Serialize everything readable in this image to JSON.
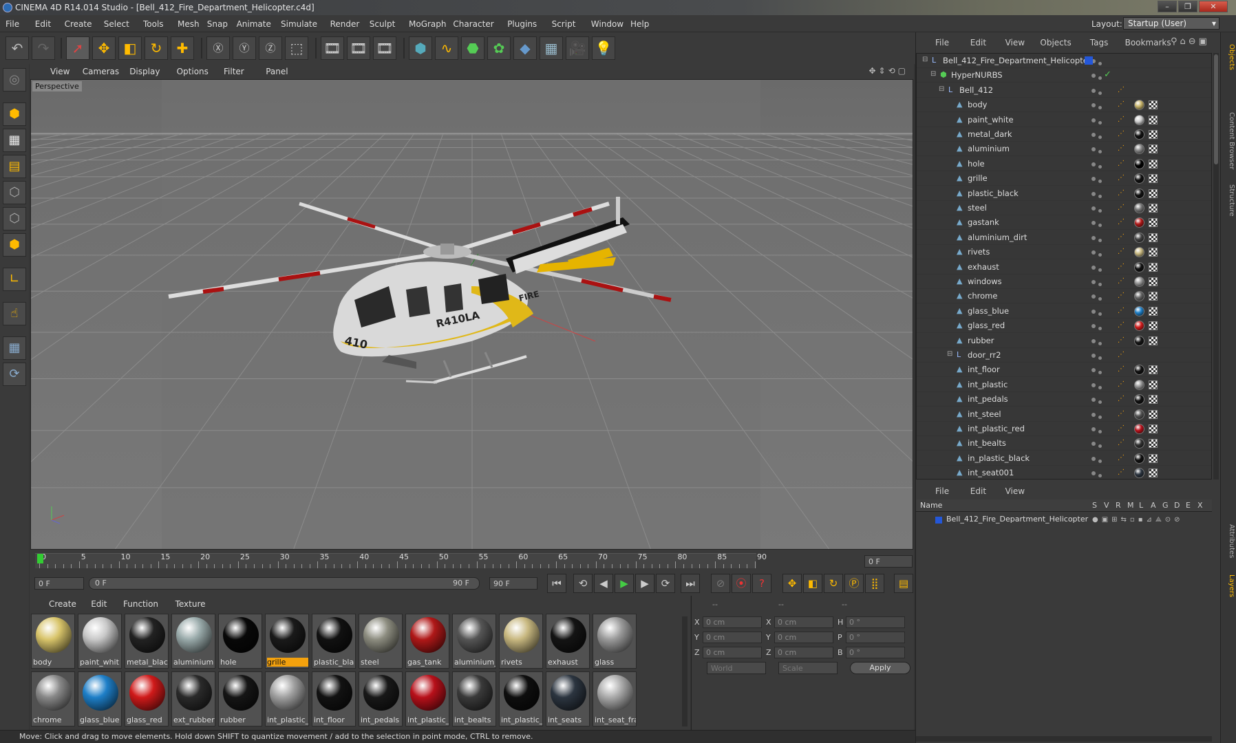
{
  "window": {
    "title": "CINEMA 4D R14.014 Studio - [Bell_412_Fire_Department_Helicopter.c4d]",
    "buttons": [
      "–",
      "❐",
      "✕"
    ]
  },
  "menubar": {
    "items": [
      "File",
      "Edit",
      "Create",
      "Select",
      "Tools",
      "Mesh",
      "Snap",
      "Animate",
      "Simulate",
      "Render",
      "Sculpt",
      "MoGraph",
      "Character",
      "Plugins",
      "Script",
      "Window",
      "Help"
    ],
    "layout_label": "Layout:",
    "layout_value": "Startup (User)"
  },
  "viewport": {
    "menu": [
      "View",
      "Cameras",
      "Display",
      "Options",
      "Filter",
      "Panel"
    ],
    "label": "Perspective",
    "model_text": [
      "410",
      "R410LA",
      "FIRE"
    ]
  },
  "timeline": {
    "ticks": [
      "0",
      "5",
      "10",
      "15",
      "20",
      "25",
      "30",
      "35",
      "40",
      "45",
      "50",
      "55",
      "60",
      "65",
      "70",
      "75",
      "80",
      "85",
      "90"
    ],
    "end_field": "0 F"
  },
  "transport": {
    "start": "0 F",
    "range_start": "0 F",
    "range_end": "90 F",
    "end": "90 F"
  },
  "materials": {
    "menu": [
      "Create",
      "Edit",
      "Function",
      "Texture"
    ],
    "items": [
      {
        "name": "body",
        "color": "#d8c46a"
      },
      {
        "name": "paint_whit",
        "color": "#c8c8c8"
      },
      {
        "name": "metal_blac",
        "color": "#222"
      },
      {
        "name": "aluminium",
        "color": "#9aa"
      },
      {
        "name": "hole",
        "color": "#080808"
      },
      {
        "name": "grille",
        "color": "#1a1a1a",
        "selected": true
      },
      {
        "name": "plastic_bla",
        "color": "#111"
      },
      {
        "name": "steel",
        "color": "#8d8d80"
      },
      {
        "name": "gas_tank",
        "color": "#b01818"
      },
      {
        "name": "aluminium_",
        "color": "#555"
      },
      {
        "name": "rivets",
        "color": "#c8b880"
      },
      {
        "name": "exhaust",
        "color": "#141414"
      },
      {
        "name": "glass",
        "color": "#9a9a9a"
      },
      {
        "name": "chrome",
        "color": "#888"
      },
      {
        "name": "glass_blue",
        "color": "#1e7fc8"
      },
      {
        "name": "glass_red",
        "color": "#d01a1a"
      },
      {
        "name": "ext_rubber",
        "color": "#2a2a2a"
      },
      {
        "name": "rubber",
        "color": "#151515"
      },
      {
        "name": "int_plastic_",
        "color": "#a0a0a0"
      },
      {
        "name": "int_floor",
        "color": "#121212"
      },
      {
        "name": "int_pedals",
        "color": "#181818"
      },
      {
        "name": "int_plastic_",
        "color": "#b8101a"
      },
      {
        "name": "int_bealts",
        "color": "#3a3a3a"
      },
      {
        "name": "int_plastic_",
        "color": "#0e0e0e"
      },
      {
        "name": "int_seats",
        "color": "#2c3540"
      },
      {
        "name": "int_seat_fra",
        "color": "#aaa"
      }
    ]
  },
  "attributes": {
    "header": [
      "--",
      "--",
      "--"
    ],
    "rows": [
      [
        "X",
        "0 cm",
        "X",
        "0 cm",
        "H",
        "0 °"
      ],
      [
        "Y",
        "0 cm",
        "Y",
        "0 cm",
        "P",
        "0 °"
      ],
      [
        "Z",
        "0 cm",
        "Z",
        "0 cm",
        "B",
        "0 °"
      ]
    ],
    "world": "World",
    "scale": "Scale",
    "apply": "Apply"
  },
  "status": "Move: Click and drag to move elements. Hold down SHIFT to quantize movement / add to the selection in point mode, CTRL to remove.",
  "objects": {
    "menu": [
      "File",
      "Edit",
      "View",
      "Objects",
      "Tags",
      "Bookmarks"
    ],
    "rows": [
      {
        "name": "Bell_412_Fire_Department_Helicopter",
        "indent": 0,
        "type": "null"
      },
      {
        "name": "HyperNURBS",
        "indent": 1,
        "type": "nurbs"
      },
      {
        "name": "Bell_412",
        "indent": 2,
        "type": "null"
      },
      {
        "name": "body",
        "indent": 3,
        "ball": "#c8b46a"
      },
      {
        "name": "paint_white",
        "indent": 3,
        "ball": "#cfcfcf"
      },
      {
        "name": "metal_dark",
        "indent": 3,
        "ball": "#111"
      },
      {
        "name": "aluminium",
        "indent": 3,
        "ball": "#888"
      },
      {
        "name": "hole",
        "indent": 3,
        "ball": "#000"
      },
      {
        "name": "grille",
        "indent": 3,
        "ball": "#111"
      },
      {
        "name": "plastic_black",
        "indent": 3,
        "ball": "#111"
      },
      {
        "name": "steel",
        "indent": 3,
        "ball": "#777"
      },
      {
        "name": "gastank",
        "indent": 3,
        "ball": "#b01818"
      },
      {
        "name": "aluminium_dirt",
        "indent": 3,
        "ball": "#444"
      },
      {
        "name": "rivets",
        "indent": 3,
        "ball": "#c8b880"
      },
      {
        "name": "exhaust",
        "indent": 3,
        "ball": "#111"
      },
      {
        "name": "windows",
        "indent": 3,
        "ball": "#999"
      },
      {
        "name": "chrome",
        "indent": 3,
        "ball": "#666"
      },
      {
        "name": "glass_blue",
        "indent": 3,
        "ball": "#1e7fc8"
      },
      {
        "name": "glass_red",
        "indent": 3,
        "ball": "#d01a1a"
      },
      {
        "name": "rubber",
        "indent": 3,
        "ball": "#151515"
      },
      {
        "name": "door_rr2",
        "indent": 3,
        "type": "null"
      },
      {
        "name": "int_floor",
        "indent": 3,
        "ball": "#111"
      },
      {
        "name": "int_plastic",
        "indent": 3,
        "ball": "#999"
      },
      {
        "name": "int_pedals",
        "indent": 3,
        "ball": "#111"
      },
      {
        "name": "int_steel",
        "indent": 3,
        "ball": "#555"
      },
      {
        "name": "int_plastic_red",
        "indent": 3,
        "ball": "#b8101a"
      },
      {
        "name": "int_bealts",
        "indent": 3,
        "ball": "#333"
      },
      {
        "name": "in_plastic_black",
        "indent": 3,
        "ball": "#111"
      },
      {
        "name": "int_seat001",
        "indent": 3,
        "ball": "#2c3540"
      }
    ]
  },
  "layers": {
    "menu": [
      "File",
      "Edit",
      "View"
    ],
    "header": {
      "name": "Name",
      "cols": [
        "S",
        "V",
        "R",
        "M",
        "L",
        "A",
        "G",
        "D",
        "E",
        "X"
      ]
    },
    "row": "Bell_412_Fire_Department_Helicopter"
  },
  "sidetabs": [
    "Objects",
    "Content Browser",
    "Structure",
    "Attributes",
    "Layers"
  ]
}
